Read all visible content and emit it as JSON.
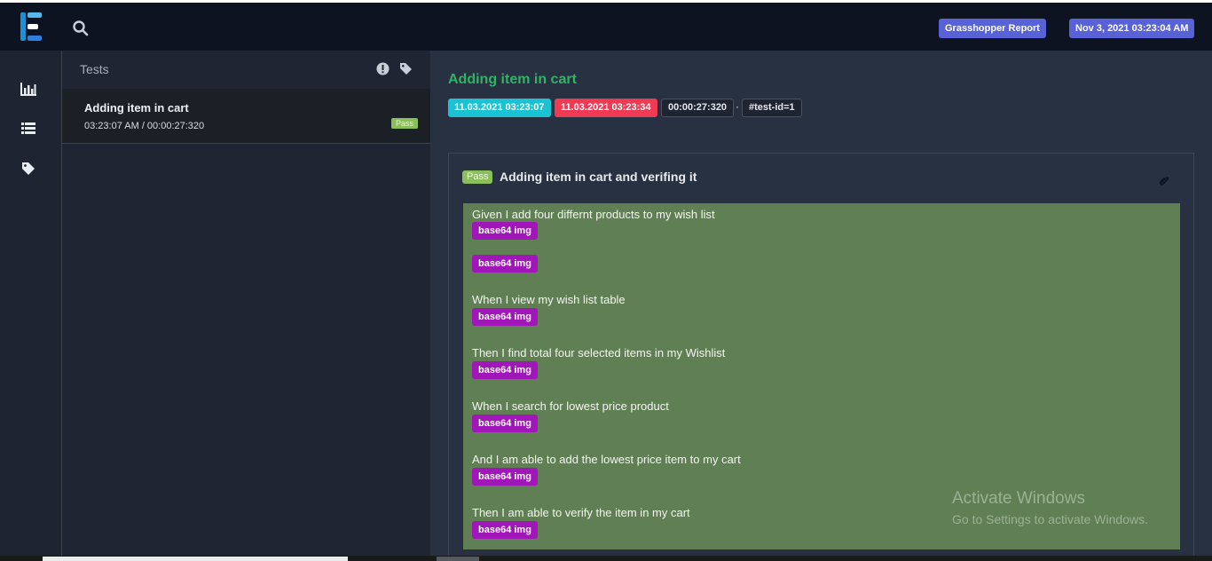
{
  "header": {
    "report_label": "Grasshopper Report",
    "date_label": "Nov 3, 2021 03:23:04 AM"
  },
  "leftnav": {
    "items": [
      {
        "icon": "bar-chart-icon"
      },
      {
        "icon": "list-icon"
      },
      {
        "icon": "tag-icon"
      }
    ]
  },
  "tests_panel": {
    "title": "Tests",
    "items": [
      {
        "name": "Adding item in cart",
        "time": "03:23:07 AM / 00:00:27:320",
        "status": "Pass"
      }
    ]
  },
  "detail": {
    "title": "Adding item in cart",
    "start": "11.03.2021 03:23:07",
    "end": "11.03.2021 03:23:34",
    "duration": "00:00:27:320",
    "separator": "·",
    "test_id": "#test-id=1",
    "scenario": {
      "status": "Pass",
      "title": "Adding item in cart and verifing it",
      "steps": [
        {
          "text": "Given I add four differnt products to my wish list",
          "media": "base64 img"
        },
        {
          "text": "",
          "media": "base64 img"
        },
        {
          "text": "When I view my wish list table",
          "media": "base64 img"
        },
        {
          "text": "Then I find total four selected items in my Wishlist",
          "media": "base64 img"
        },
        {
          "text": "When I search for lowest price product",
          "media": "base64 img"
        },
        {
          "text": "And I am able to add the lowest price item to my cart",
          "media": "base64 img"
        },
        {
          "text": "Then I am able to verify the item in my cart",
          "media": "base64 img"
        }
      ]
    }
  },
  "watermark": {
    "line1": "Activate Windows",
    "line2": "Go to Settings to activate Windows."
  },
  "colors": {
    "accent": "#5961d6",
    "pass": "#8bbf5c",
    "title_green": "#2fb464",
    "start_chip": "#1bc2d1",
    "end_chip": "#ef3a54",
    "media_button": "#a016b8",
    "step_background": "#607f54"
  }
}
